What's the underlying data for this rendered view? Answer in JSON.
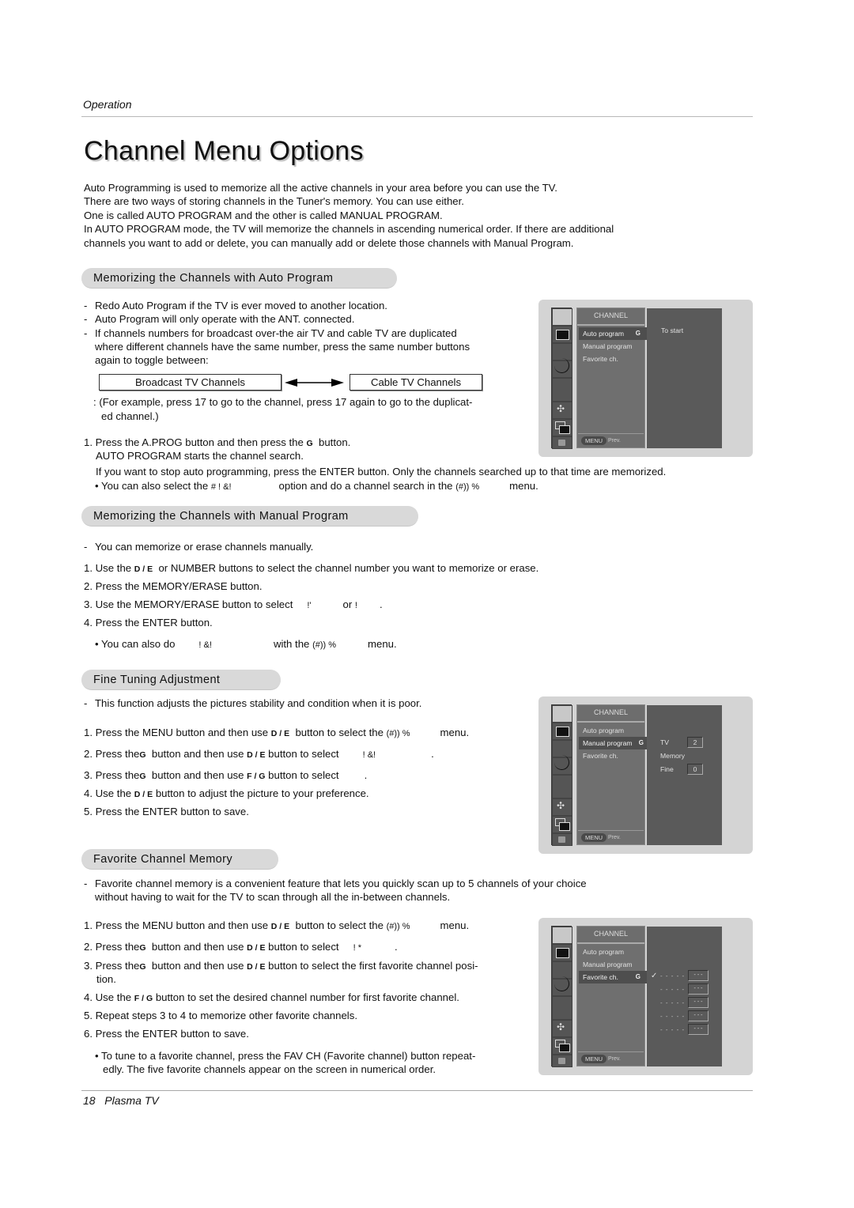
{
  "header": {
    "section": "Operation",
    "title": "Channel Menu Options"
  },
  "intro": [
    "Auto Programming is used to memorize all the active channels in your area before you can use the TV.",
    "There are two ways of storing channels in the Tuner's memory. You can use either.",
    "One is called AUTO PROGRAM and the other is called MANUAL PROGRAM.",
    "In AUTO PROGRAM mode, the TV will memorize the channels in ascending numerical order. If there are additional",
    "channels you want to add or delete, you can manually add or delete those channels with Manual Program."
  ],
  "auto": {
    "heading": "Memorizing the Channels with Auto Program",
    "bullets": [
      "Redo Auto Program if the TV is ever moved to another location.",
      "Auto Program will only operate with the ANT. connected.",
      "If channels numbers for broadcast over-the air TV and cable TV are duplicated",
      "where different channels have the same number, press the same number buttons",
      "again to toggle between:"
    ],
    "toggle_left": "Broadcast TV Channels",
    "toggle_right": "Cable TV Channels",
    "example_1": ": (For example, press 17 to go to the channel, press 17 again to go to the duplicat-",
    "example_2": "ed channel.)",
    "step1_a": "1. Press the A.PROG button and then press the",
    "step1_glyph": "G",
    "step1_b": "button.",
    "step1_c": "AUTO PROGRAM starts the channel search.",
    "stop_note": "If you want to stop auto programming, press the ENTER button. Only the channels searched up to that time are memorized.",
    "also_a": "• You can also select the",
    "also_code1": "#    ! &!",
    "also_b": "option and do a channel search in the",
    "also_code2": "(#)) %",
    "also_c": "menu."
  },
  "manual": {
    "heading": "Memorizing the Channels with Manual Program",
    "bullet": "You can memorize or erase channels manually.",
    "s1_a": "1. Use the",
    "s1_glyph": "D  / E",
    "s1_b": "or NUMBER buttons to select the channel number you want to memorize or erase.",
    "s2": "2. Press the MEMORY/ERASE button.",
    "s3_a": "3. Use the MEMORY/ERASE button to select",
    "s3_code1": "!'",
    "s3_or": "or",
    "s3_code2": "!",
    "s3_end": ".",
    "s4": "4. Press the ENTER button.",
    "also_a": "• You can also do",
    "also_code1": "! &!",
    "also_b": "with the",
    "also_code2": "(#)) %",
    "also_c": "menu."
  },
  "fine": {
    "heading": "Fine Tuning Adjustment",
    "bullet": "This function adjusts the pictures stability and condition when it is poor.",
    "s1_a": "1. Press the MENU button and then use",
    "s1_glyph": "D  / E",
    "s1_b": "button to select the",
    "s1_code": "(#)) %",
    "s1_c": "menu.",
    "s2_a": "2. Press the",
    "s2_glyph": "G",
    "s2_b": "button and then use",
    "s2_glyph2": "D  / E",
    "s2_c": "button to select",
    "s2_code": "! &!",
    "s2_end": ".",
    "s3_a": "3. Press the",
    "s3_glyph": "G",
    "s3_b": "button and then use",
    "s3_glyph2": "F  / G",
    "s3_c": "button to select",
    "s3_end": ".",
    "s4_a": "4. Use the",
    "s4_glyph": "D  / E",
    "s4_b": "button to adjust the picture to your preference.",
    "s5": "5. Press the ENTER button to save."
  },
  "favorite": {
    "heading": "Favorite Channel Memory",
    "bullet_1": "Favorite channel memory is a convenient feature that lets you quickly scan up to 5 channels of your choice",
    "bullet_2": "without having to wait for the TV to scan through all the in-between channels.",
    "s1_a": "1. Press the MENU button and then use",
    "s1_glyph": "D  / E",
    "s1_b": "button to select the",
    "s1_code": "(#)) %",
    "s1_c": "menu.",
    "s2_a": "2. Press the",
    "s2_glyph": "G",
    "s2_b": "button and then use",
    "s2_glyph2": "D  / E",
    "s2_c": "button to select",
    "s2_code": "!    *",
    "s2_end": ".",
    "s3_a": "3. Press the",
    "s3_glyph": "G",
    "s3_b": "button and then use",
    "s3_glyph2": "D  / E",
    "s3_c": "button to select the first favorite channel posi-",
    "s3_d": "tion.",
    "s4_a": "4. Use the",
    "s4_glyph": "F  / G",
    "s4_b": "button to set the desired channel number for first favorite channel.",
    "s5": "5. Repeat steps 3 to 4 to memorize other favorite channels.",
    "s6": "6. Press the ENTER button to save.",
    "tip_1": "• To tune to a favorite channel, press the FAV CH (Favorite channel) button repeat-",
    "tip_2": "edly. The five favorite channels appear on the screen in numerical order."
  },
  "osd": {
    "menu_title": "CHANNEL",
    "items": [
      "Auto program",
      "Manual program",
      "Favorite ch."
    ],
    "arrow_glyph": "G",
    "menu_button": "MENU",
    "prev_label": "Prev.",
    "auto_hint": "To start",
    "manual_tv_label": "TV",
    "manual_tv_value": "2",
    "manual_memory_label": "Memory",
    "manual_fine_label": "Fine",
    "manual_fine_value": "0",
    "fav_check": "✓",
    "fav_slots": [
      {
        "name": "- - - - -",
        "value": "- - -"
      },
      {
        "name": "- - - - -",
        "value": "- - -"
      },
      {
        "name": "- - - - -",
        "value": "- - -"
      },
      {
        "name": "- - - - -",
        "value": "- - -"
      },
      {
        "name": "- - - - -",
        "value": "- - -"
      }
    ]
  },
  "footer": {
    "page": "18",
    "product": "Plasma TV"
  }
}
